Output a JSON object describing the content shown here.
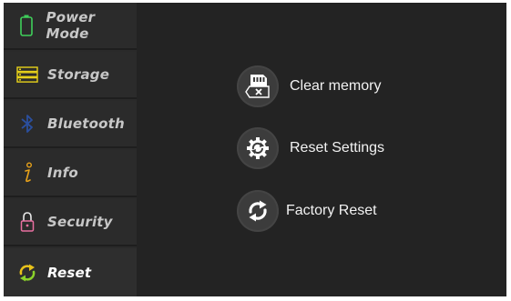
{
  "sidebar": {
    "items": [
      {
        "label": "Power Mode",
        "icon": "battery-icon",
        "active": false
      },
      {
        "label": "Storage",
        "icon": "storage-icon",
        "active": false
      },
      {
        "label": "Bluetooth",
        "icon": "bluetooth-icon",
        "active": false
      },
      {
        "label": "Info",
        "icon": "info-icon",
        "active": false
      },
      {
        "label": "Security",
        "icon": "lock-icon",
        "active": false
      },
      {
        "label": "Reset",
        "icon": "reset-icon",
        "active": true
      }
    ]
  },
  "main": {
    "actions": [
      {
        "label": "Clear memory",
        "icon": "sd-card-clear-icon"
      },
      {
        "label": "Reset Settings",
        "icon": "gear-reset-icon"
      },
      {
        "label": "Factory Reset",
        "icon": "refresh-icon"
      }
    ]
  },
  "colors": {
    "background": "#232323",
    "sidebar": "#2b2b2b",
    "battery_green": "#3fcf5a",
    "storage_yellow": "#e8d21a",
    "bluetooth_blue": "#2b4f9e",
    "info_orange": "#e8a21a",
    "lock_pink": "#e86fa0",
    "reset_green": "#8bd22a",
    "reset_yellow": "#e8c21a"
  }
}
